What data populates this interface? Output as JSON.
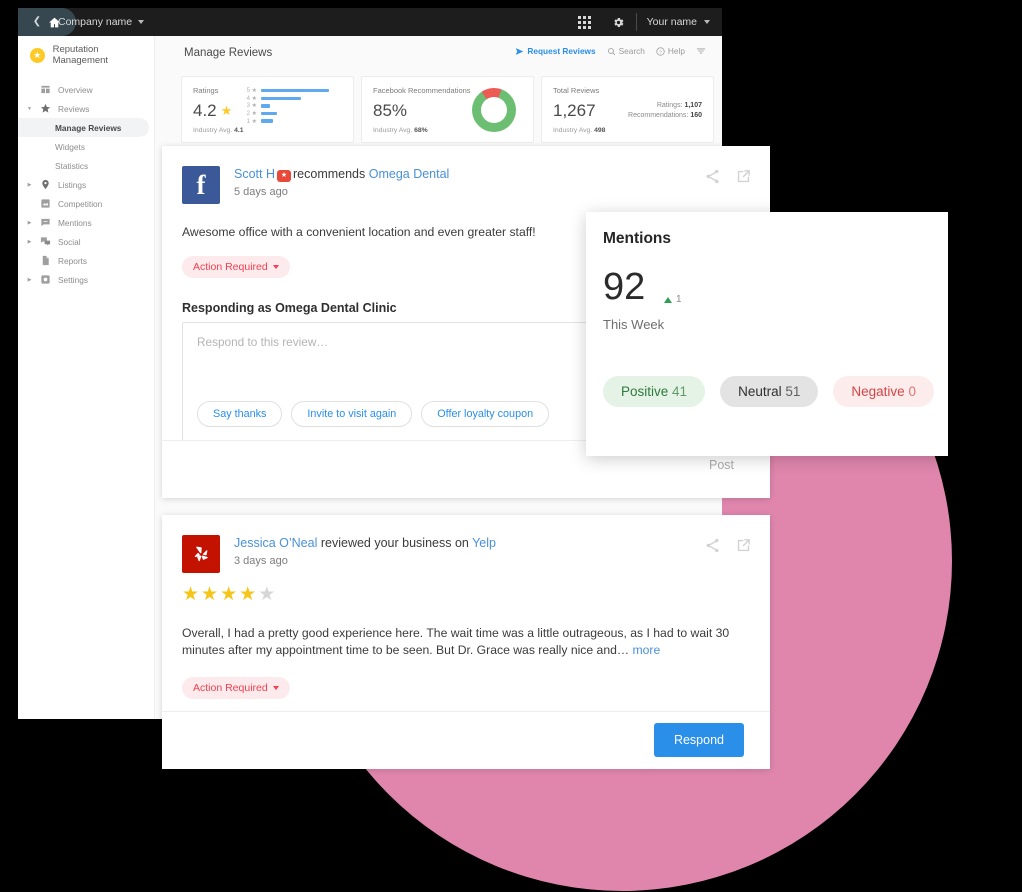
{
  "topbar": {
    "company": "Company name",
    "user": "Your name",
    "icons": [
      "back-icon",
      "home-icon",
      "apps-grid-icon",
      "gear-icon",
      "chevron-down-icon"
    ]
  },
  "sidebar": {
    "brand": "Reputation Management",
    "items": [
      {
        "label": "Overview",
        "icon": "dashboard-icon",
        "expandable": false
      },
      {
        "label": "Reviews",
        "icon": "star-icon",
        "expandable": true,
        "expanded": true
      },
      {
        "label": "Listings",
        "icon": "location-pin-icon",
        "expandable": true
      },
      {
        "label": "Competition",
        "icon": "competition-icon",
        "expandable": false
      },
      {
        "label": "Mentions",
        "icon": "comment-icon",
        "expandable": true
      },
      {
        "label": "Social",
        "icon": "social-icon",
        "expandable": true
      },
      {
        "label": "Reports",
        "icon": "document-icon",
        "expandable": false
      },
      {
        "label": "Settings",
        "icon": "settings-icon",
        "expandable": true
      }
    ],
    "sub_items": [
      {
        "label": "Manage Reviews",
        "active": true
      },
      {
        "label": "Widgets",
        "active": false
      },
      {
        "label": "Statistics",
        "active": false
      }
    ]
  },
  "content": {
    "title": "Manage Reviews",
    "tools": [
      {
        "label": "Request Reviews",
        "icon": "send-icon"
      },
      {
        "label": "Search",
        "icon": "search-icon"
      },
      {
        "label": "Help",
        "icon": "help-circle-icon"
      },
      {
        "label": "",
        "icon": "filter-icon"
      }
    ]
  },
  "chart_data": [
    {
      "type": "bar",
      "title": "Ratings",
      "orientation": "horizontal",
      "categories": [
        "5 ★",
        "4 ★",
        "3 ★",
        "2 ★",
        "1 ★"
      ],
      "values": [
        68,
        40,
        9,
        16,
        12
      ],
      "value_unit": "relative count (px width of bar)",
      "headline_value": "4.2",
      "industry_avg_label": "Industry Avg.",
      "industry_avg_value": "4.1",
      "bar_color": "#5fa9ee",
      "grid": false,
      "legend": false
    },
    {
      "type": "pie",
      "subtype": "donut",
      "title": "Facebook Recommendations",
      "categories": [
        "Recommended",
        "Not recommended"
      ],
      "values": [
        85,
        15
      ],
      "headline_value": "85%",
      "industry_avg_label": "Industry Avg.",
      "industry_avg_value": "68%",
      "colors": [
        "#6cbf72",
        "#ec5b54"
      ],
      "legend": false
    },
    {
      "type": "table",
      "title": "Total Reviews",
      "headline_value": "1,267",
      "industry_avg_label": "Industry Avg.",
      "industry_avg_value": "498",
      "rows": [
        {
          "label": "Ratings:",
          "value": "1,107"
        },
        {
          "label": "Recommendations:",
          "value": "160"
        }
      ]
    }
  ],
  "reviews": [
    {
      "source": "Facebook",
      "avatar_icon": "facebook-icon",
      "author": "Scott H",
      "action": "recommends",
      "business": "Omega Dental",
      "time": "5 days ago",
      "badge_icon": "recommend-badge-icon",
      "text": "Awesome office with a convenient location and even greater staff!",
      "status": "Action Required",
      "responding_as": "Responding as Omega Dental Clinic",
      "reply_placeholder": "Respond to this review…",
      "quick_replies": [
        "Say thanks",
        "Invite to visit again",
        "Offer loyalty coupon"
      ],
      "post_label": "Post",
      "icons": [
        "share-icon",
        "external-link-icon"
      ]
    },
    {
      "source": "Yelp",
      "avatar_icon": "yelp-icon",
      "author": "Jessica O’Neal",
      "action": "reviewed your business on",
      "business": "Yelp",
      "time": "3 days ago",
      "rating": 4,
      "rating_max": 5,
      "text": "Overall, I had a pretty good experience here. The wait time was a little outrageous, as I had to wait 30 minutes after my appointment time to be seen. But Dr. Grace was really nice and…",
      "more_label": "more",
      "status": "Action Required",
      "respond_label": "Respond",
      "icons": [
        "share-icon",
        "external-link-icon"
      ]
    }
  ],
  "mentions": {
    "title": "Mentions",
    "count": "92",
    "delta": "1",
    "delta_direction": "up",
    "period": "This Week",
    "sentiments": [
      {
        "label": "Positive",
        "value": "41",
        "color": "#2f7a3d"
      },
      {
        "label": "Neutral",
        "value": "51",
        "color": "#2f2f2f"
      },
      {
        "label": "Negative",
        "value": "0",
        "color": "#d64545"
      }
    ]
  },
  "theme": {
    "accent": "#2a8fe8",
    "decor_circle": "#e086ad",
    "background": "#000000",
    "action_required": "#f0424f"
  }
}
